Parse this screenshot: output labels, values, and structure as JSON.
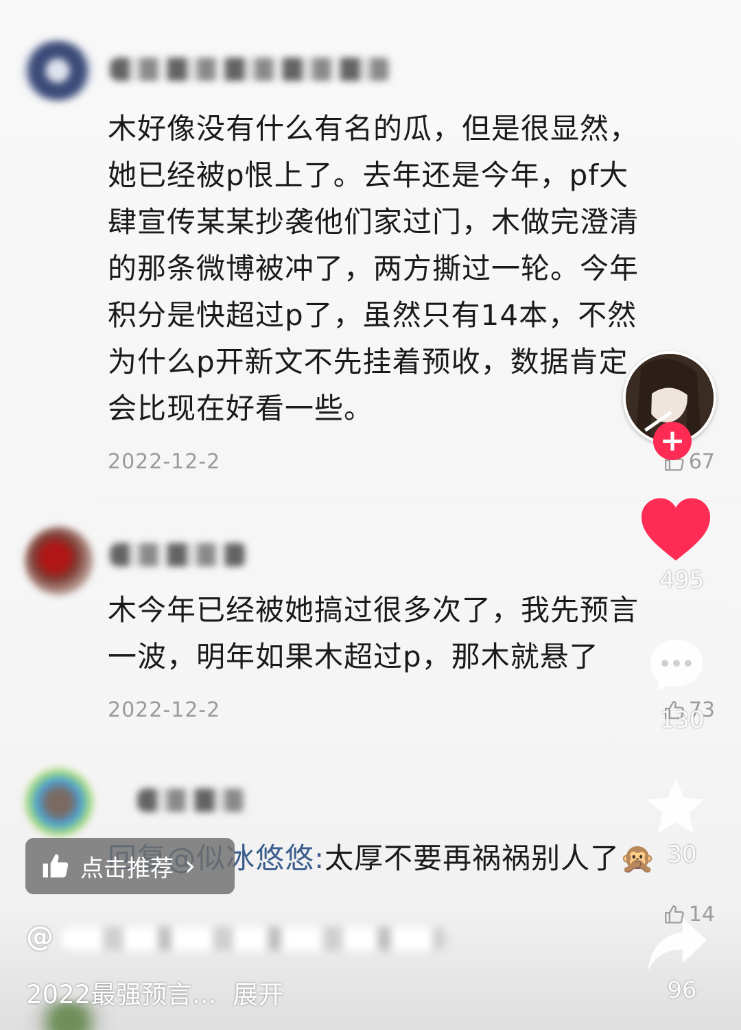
{
  "comments": [
    {
      "lines": [
        "木好像没有什么有名的瓜，但是很显然，",
        "她已经被p恨上了。去年还是今年，pf大",
        "肆宣传某某抄袭他们家过门，木做完澄清",
        "的那条微博被冲了，两方撕过一轮。今年",
        "积分是快超过p了，虽然只有14本，不然",
        "为什么p开新文不先挂着预收，数据肯定",
        "会比现在好看一些。"
      ],
      "date": "2022-12-2",
      "likes": "67"
    },
    {
      "lines": [
        "木今年已经被她搞过很多次了，我先预言",
        "一波，明年如果木超过p，那木就悬了"
      ],
      "date": "2022-12-2",
      "likes": "73"
    },
    {
      "reply_prefix": "回复@似冰悠悠:",
      "text": "太厚不要再祸祸别人了🙊",
      "likes": "14"
    }
  ],
  "video_rail": {
    "follow_symbol": "+",
    "like_count": "495",
    "comment_count": "130",
    "favorite_count": "30",
    "share_count": "96"
  },
  "recommend_button": {
    "label": "点击推荐",
    "arrow": "›"
  },
  "author_prefix": "@",
  "caption": {
    "text": "2022最强预言...",
    "expand": "展开"
  },
  "colors": {
    "like_red": "#fe2c55",
    "reply_blue": "#3b5e8c"
  }
}
